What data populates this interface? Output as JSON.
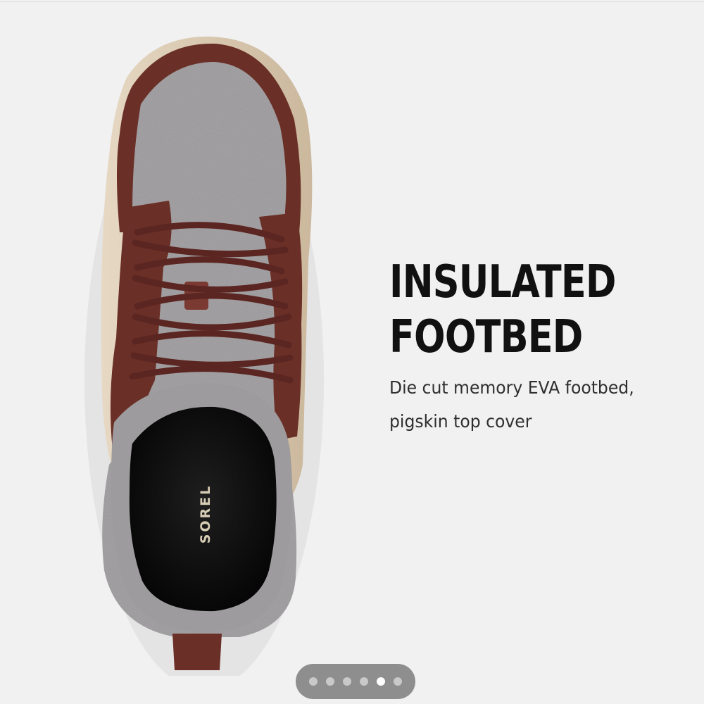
{
  "slide": {
    "headline_lines": [
      "INSULATED",
      "FOOTBED"
    ],
    "description_lines": [
      "Die cut memory EVA footbed,",
      "pigskin top cover"
    ],
    "image": {
      "brand_mark": "SOREL",
      "colors": {
        "leather": "#6a2f27",
        "felt": "#a6a4a6",
        "sole": "#d9c9b4",
        "lining": "#111111"
      }
    }
  },
  "pager": {
    "total": 6,
    "current": 5,
    "dots": [
      {
        "active": false
      },
      {
        "active": false
      },
      {
        "active": false
      },
      {
        "active": false
      },
      {
        "active": true
      },
      {
        "active": false
      }
    ]
  }
}
